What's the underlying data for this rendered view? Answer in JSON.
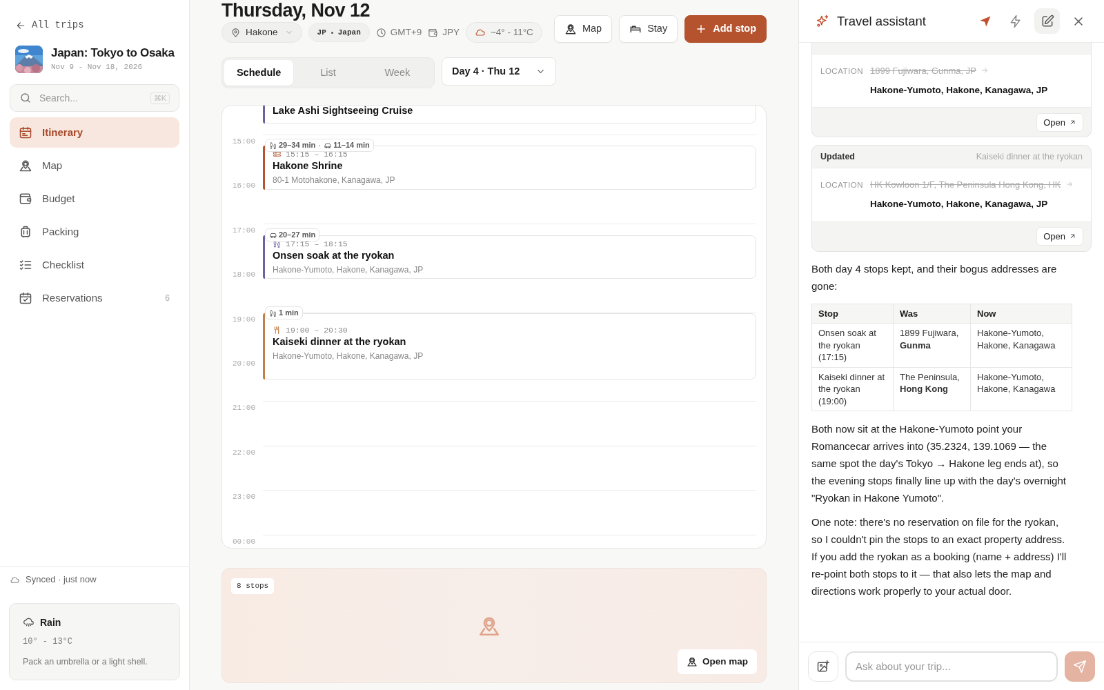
{
  "sidebar": {
    "back_link": "All trips",
    "trip": {
      "title": "Japan: Tokyo to Osaka",
      "dates": "Nov 9 - Nov 18, 2026"
    },
    "search": {
      "placeholder": "Search...",
      "shortcut": "⌘K"
    },
    "nav": [
      {
        "label": "Itinerary",
        "selected": true
      },
      {
        "label": "Map",
        "selected": false
      },
      {
        "label": "Budget",
        "selected": false
      },
      {
        "label": "Packing",
        "selected": false
      },
      {
        "label": "Checklist",
        "selected": false
      },
      {
        "label": "Reservations",
        "selected": false,
        "badge": "6"
      }
    ],
    "sync_status": "Synced · just now",
    "weather": {
      "condition": "Rain",
      "range": "10° - 13°C",
      "tip": "Pack an umbrella or a light shell."
    }
  },
  "day": {
    "title": "Thursday, Nov 12",
    "place": "Hakone",
    "country_code": "JP",
    "country": "Japan",
    "timezone": "GMT+9",
    "currency": "JPY",
    "temperature": "~4° - 11°C",
    "actions": [
      {
        "label": "Map",
        "kind": "secondary"
      },
      {
        "label": "Stay",
        "kind": "secondary"
      },
      {
        "label": "Add stop",
        "kind": "primary"
      }
    ]
  },
  "view_tabs": [
    {
      "label": "Schedule",
      "selected": true
    },
    {
      "label": "List",
      "selected": false
    },
    {
      "label": "Week",
      "selected": false
    }
  ],
  "day_picker": "Day 4 · Thu 12",
  "schedule": {
    "hours": [
      "15:00",
      "16:00",
      "17:00",
      "18:00",
      "19:00",
      "20:00",
      "21:00",
      "22:00",
      "23:00",
      "00:00"
    ],
    "events": [
      {
        "title": "Lake Ashi Sightseeing Cruise",
        "color": "#6b63a0"
      },
      {
        "travel": [
          {
            "kind": "walk",
            "text": "29–34 min"
          },
          {
            "kind": "car",
            "text": "11–14 min"
          }
        ],
        "kind": "ticket",
        "time": "15:15 – 16:15",
        "title": "Hakone Shrine",
        "address": "80-1 Motohakone, Kanagawa, JP",
        "color": "#b5532f"
      },
      {
        "travel": [
          {
            "kind": "car",
            "text": "20–27 min"
          }
        ],
        "kind": "walk",
        "time": "17:15 – 18:15",
        "title": "Onsen soak at the ryokan",
        "address": "Hakone-Yumoto, Hakone, Kanagawa, JP",
        "color": "#6b63a0"
      },
      {
        "travel": [
          {
            "kind": "walk",
            "text": "1 min"
          }
        ],
        "kind": "dining",
        "time": "19:00 – 20:30",
        "title": "Kaiseki dinner at the ryokan",
        "address": "Hakone-Yumoto, Hakone, Kanagawa, JP",
        "color": "#c0804a"
      }
    ]
  },
  "map_preview": {
    "stop_count": "8 stops",
    "button": "Open map"
  },
  "assistant": {
    "title": "Travel assistant",
    "updates": [
      {
        "field": "LOCATION",
        "old": "1899 Fujiwara, Gunma, JP",
        "new": "Hakone-Yumoto, Hakone, Kanagawa, JP",
        "button": "Open"
      },
      {
        "status": "Updated",
        "stop": "Kaiseki dinner at the ryokan",
        "field": "LOCATION",
        "old": "HK Kowloon 1/F, The Peninsula Hong Kong, HK",
        "new": "Hakone-Yumoto, Hakone, Kanagawa, JP",
        "button": "Open"
      }
    ],
    "content": [
      {
        "kind": "paragraph",
        "text": "Both day 4 stops kept, and their bogus addresses are gone:"
      },
      {
        "kind": "table",
        "columns": [
          "Stop",
          "Was",
          "Now"
        ],
        "rows": [
          [
            "Onsen soak at the ryokan (17:15)",
            "1899 Fujiwara, **Gunma**",
            "Hakone-Yumoto, Hakone, Kanagawa"
          ],
          [
            "Kaiseki dinner at the ryokan (19:00)",
            "The Peninsula, **Hong Kong**",
            "Hakone-Yumoto, Hakone, Kanagawa"
          ]
        ]
      },
      {
        "kind": "paragraph",
        "text": "Both now sit at the Hakone-Yumoto point your Romancecar arrives into (35.2324, 139.1069 — the same spot the day's Tokyo → Hakone leg ends at), so the evening stops finally line up with the day's overnight \"Ryokan in Hakone Yumoto\"."
      },
      {
        "kind": "paragraph",
        "text": "One note: there's no reservation on file for the ryokan, so I couldn't pin the stops to an exact property address. If you add the ryokan as a booking (name + address) I'll re-point both stops to it — that also lets the map and directions work properly to your actual door."
      }
    ],
    "input": {
      "placeholder": "Ask about your trip..."
    }
  }
}
